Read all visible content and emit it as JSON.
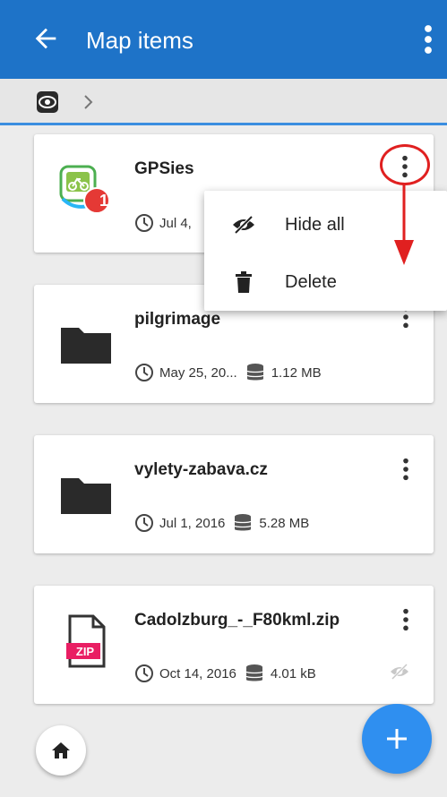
{
  "appbar": {
    "title": "Map items",
    "bg_color": "#1e73c8"
  },
  "breadcrumb": {
    "root_icon": "map-items-root-icon",
    "separator_icon": "chevron-right-icon"
  },
  "items": [
    {
      "name": "GPSies",
      "date": "Jul 4,",
      "icon": "gpsies-bike-icon",
      "badge": "1"
    },
    {
      "name": "pilgrimage",
      "date": "May 25, 20...",
      "size": "1.12 MB",
      "icon": "folder-icon"
    },
    {
      "name": "vylety-zabava.cz",
      "date": "Jul 1, 2016",
      "size": "5.28 MB",
      "icon": "folder-icon"
    },
    {
      "name": "Cadolzburg_-_F80kml.zip",
      "date": "Oct 14, 2016",
      "size": "4.01 kB",
      "icon": "zip-file-icon",
      "zip_label": "ZIP"
    }
  ],
  "popup_menu": {
    "items": [
      {
        "label": "Hide all",
        "icon": "eye-off-icon"
      },
      {
        "label": "Delete",
        "icon": "trash-icon"
      }
    ]
  },
  "accent_color": "#2f8ff0",
  "annotation_color": "#e02020"
}
